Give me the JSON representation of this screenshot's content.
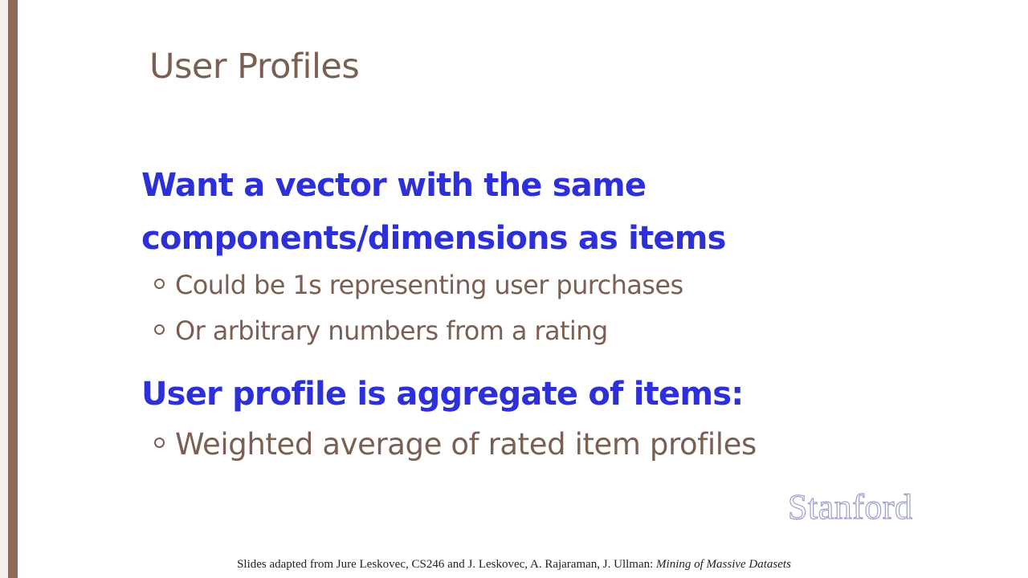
{
  "slide": {
    "title": "User Profiles",
    "heading1_line1": "Want a vector with the same",
    "heading1_line2": "components/dimensions as items",
    "bullets1": [
      "Could be 1s representing user purchases",
      "Or arbitrary numbers from a rating"
    ],
    "heading2": "User profile is aggregate of items:",
    "bullets2": [
      "Weighted average of rated item profiles"
    ],
    "logo_text": "Stanford",
    "footer_text": "Slides adapted from  Jure Leskovec, CS246 and J. Leskovec, A. Rajaraman, J. Ullman: ",
    "footer_italic": "Mining of Massive Datasets"
  },
  "colors": {
    "heading": "#2d2fd8",
    "body": "#7a5f52",
    "accent_bar": "#8c6b58",
    "logo": "#9b9fcf"
  }
}
